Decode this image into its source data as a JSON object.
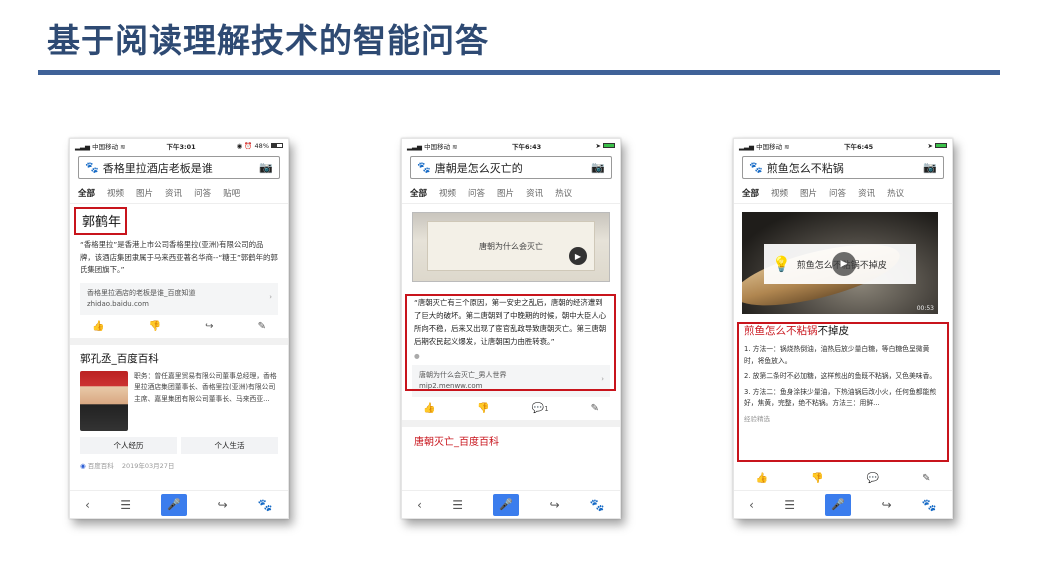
{
  "slide": {
    "title": "基于阅读理解技术的智能问答"
  },
  "colors": {
    "title": "#2e4a73",
    "rule": "#3f6298",
    "highlight": "#c8141c",
    "baidu_blue": "#3b7ded"
  },
  "tabs": [
    "全部",
    "视频",
    "图片",
    "资讯",
    "问答",
    "贴吧",
    "热议"
  ],
  "phone1": {
    "status": {
      "carrier": "中国移动",
      "time": "下午3:01",
      "battery": "48%"
    },
    "query": "香格里拉酒店老板是谁",
    "answer": "郭鹤年",
    "snippet": "“香格里拉”是香港上市公司香格里拉(亚洲)有限公司的品牌，该酒店集团隶属于马来西亚著名华商--“糖王”郭鹤年的郭氏集团旗下。”",
    "source_title": "香格里拉酒店的老板是谁_百度知道",
    "source_url": "zhidao.baidu.com",
    "baike_title": "郭孔丞_百度百科",
    "baike_text": "职务：曾任嘉里贸易有限公司董事总经理，香格里拉酒店集团董事长、香格里拉(亚洲)有限公司主席、嘉里集团有限公司董事长、马来西亚...",
    "buttons": [
      "个人经历",
      "个人生活"
    ],
    "footer": "百度百科",
    "footer_date": "2019年03月27日"
  },
  "phone2": {
    "status": {
      "carrier": "中国移动",
      "time": "下午6:43"
    },
    "query": "唐朝是怎么灭亡的",
    "video_title": "唐朝为什么会灭亡",
    "snippet": "“唐朝灭亡有三个原因，第一安史之乱后，唐朝的经济遭到了巨大的破坏。第二唐朝到了中晚期的时候，朝中大臣人心所向不稳，后来又出现了宦官乱政导致唐朝灭亡。第三唐朝后期农民起义爆发，让唐朝国力由胜转衰。”",
    "source_title": "唐朝为什么会灭亡_男人世界",
    "source_url": "mip2.menww.com",
    "comment_count": "1",
    "next_title": "唐朝灭亡_百度百科"
  },
  "phone3": {
    "status": {
      "carrier": "中国移动",
      "time": "下午6:45"
    },
    "query": "煎鱼怎么不粘锅",
    "video_overlay": "煎鱼怎么不粘锅不掉皮",
    "video_duration": "00:53",
    "answer_title_red": "煎鱼怎么不粘锅",
    "answer_title_rest": "不掉皮",
    "steps": [
      "1. 方法一：锅烧热倒油，油热后放少量白糖，等白糖色呈微黄时，将鱼放入。",
      "2. 放第二条时不必加糖，这样煎出的鱼既不粘锅，又色美味香。",
      "3. 方法二：鱼身涂抹少量油，下热油锅后改小火，任何鱼都能煎好，焦黄，完整，绝不粘锅。方法三：用鲜..."
    ],
    "source": "经验精选"
  }
}
